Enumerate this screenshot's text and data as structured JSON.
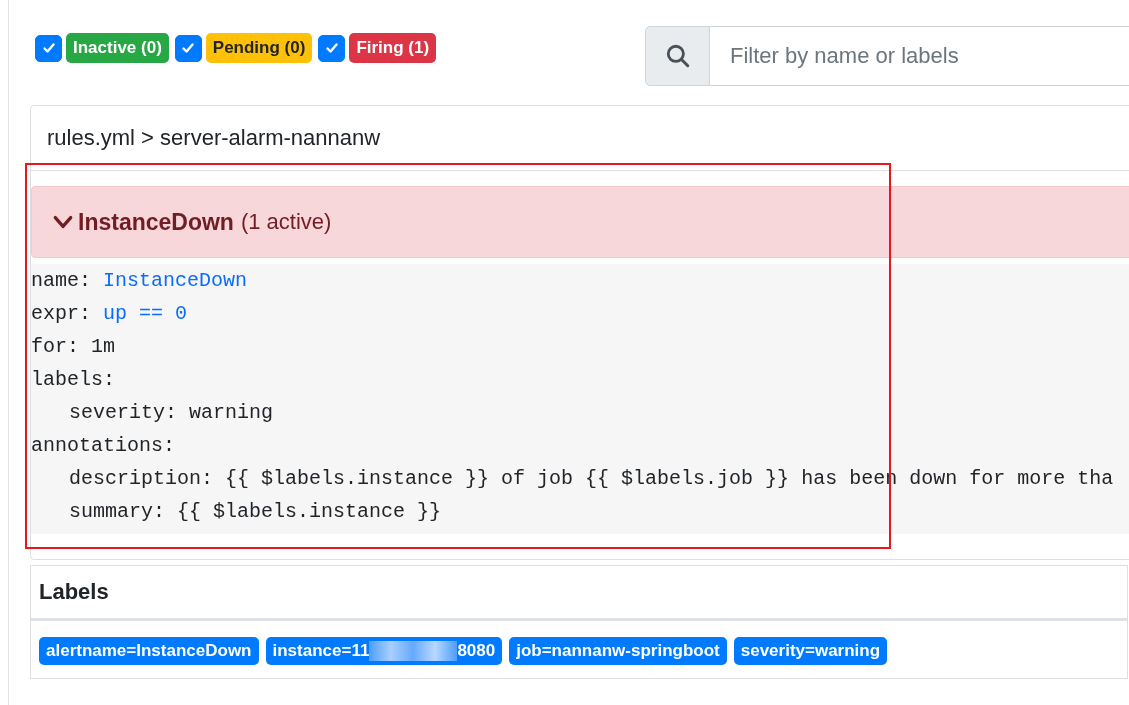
{
  "filters": [
    {
      "label": "Inactive (0)",
      "checked": true,
      "color": "#28a745"
    },
    {
      "label": "Pending (0)",
      "checked": true,
      "color": "#ffc107"
    },
    {
      "label": "Firing (1)",
      "checked": true,
      "color": "#dc3545"
    }
  ],
  "search": {
    "placeholder": "Filter by name or labels"
  },
  "group": {
    "title": "rules.yml > server-alarm-nannanw"
  },
  "alert": {
    "name": "InstanceDown",
    "count": "(1 active)",
    "expanded": true
  },
  "rule": [
    {
      "key": "name:",
      "value": "InstanceDown",
      "highlighted": true
    },
    {
      "key": "expr:",
      "value": "up == 0",
      "highlighted": true
    },
    {
      "key": "for:",
      "value": "1m",
      "highlighted": false
    },
    {
      "key": "labels:",
      "children": [
        {
          "key": "severity:",
          "value": "warning",
          "highlighted": false
        }
      ]
    },
    {
      "key": "annotations:",
      "children": [
        {
          "key": "description:",
          "value": "{{ $labels.instance }} of job {{ $labels.job }} has been down for more tha",
          "highlighted": false
        },
        {
          "key": "summary:",
          "value": "{{ $labels.instance }}",
          "highlighted": false
        }
      ]
    }
  ],
  "labels": {
    "title": "Labels",
    "items": [
      {
        "text": "alertname=InstanceDown"
      },
      {
        "text": "instance=11",
        "redacted": true,
        "suffix": "8080"
      },
      {
        "text": "job=nannanw-springboot"
      },
      {
        "text": "severity=warning"
      }
    ]
  }
}
